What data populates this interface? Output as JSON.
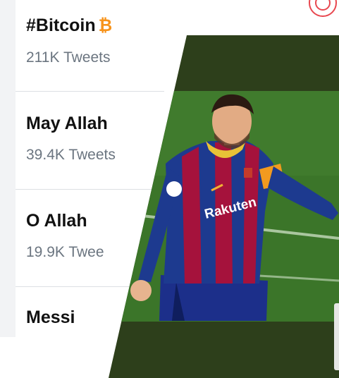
{
  "trends": [
    {
      "title": "#Bitcoin",
      "count": "211K Tweets",
      "icon": "bitcoin-icon"
    },
    {
      "title": "May Allah",
      "count": "39.4K Tweets"
    },
    {
      "title": "O Allah",
      "count": "19.9K Twee"
    },
    {
      "title": "Messi",
      "count": ""
    }
  ],
  "btc_symbol": "₿",
  "colors": {
    "accent_bitcoin": "#f7931a",
    "pitch_green": "#3d7a2a",
    "photo_frame": "#2d3f1b",
    "kit_blue": "#1d3a8f",
    "kit_red": "#a5123c"
  },
  "photo": {
    "shirt_sponsor": "Rakuten"
  }
}
